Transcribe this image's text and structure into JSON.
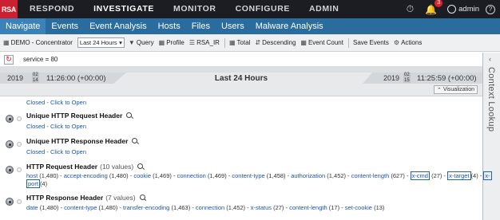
{
  "topnav": {
    "logo": "RSA",
    "items": [
      "RESPOND",
      "INVESTIGATE",
      "MONITOR",
      "CONFIGURE",
      "ADMIN"
    ],
    "active": "INVESTIGATE",
    "notifications_count": "3",
    "user": "admin"
  },
  "subnav": {
    "tabs": [
      "Navigate",
      "Events",
      "Event Analysis",
      "Hosts",
      "Files",
      "Users",
      "Malware Analysis"
    ],
    "active": "Navigate"
  },
  "toolbar": {
    "service": "DEMO - Concentrator",
    "time_range": "Last 24 Hours",
    "query": "Query",
    "profile": "Profile",
    "rsa_ir": "RSA_IR",
    "total": "Total",
    "sort": "Descending",
    "event_count": "Event Count",
    "save_events": "Save Events",
    "actions": "Actions"
  },
  "filter": {
    "text": "service = 80"
  },
  "timeline": {
    "start_year": "2019",
    "start_month": "02",
    "start_day": "14",
    "start_time": "11:26:00 (+00:00)",
    "label": "Last 24 Hours",
    "end_year": "2019",
    "end_month": "02",
    "end_day": "15",
    "end_time": "11:25:59 (+00:00)",
    "visualization": "Visualization"
  },
  "context_lookup": "Context Lookup",
  "meta": {
    "closed_link": "Closed - Click to Open",
    "uniq_req_title": "Unique HTTP Request Header",
    "uniq_resp_title": "Unique HTTP Response Header",
    "req_title": "HTTP Request Header",
    "req_count": "(10 values)",
    "req_values": [
      {
        "name": "host",
        "count": "(1,480)"
      },
      {
        "name": "accept-encoding",
        "count": "(1,480)"
      },
      {
        "name": "cookie",
        "count": "(1,469)"
      },
      {
        "name": "connection",
        "count": "(1,469)"
      },
      {
        "name": "content-type",
        "count": "(1,458)"
      },
      {
        "name": "authorization",
        "count": "(1,452)"
      },
      {
        "name": "content-length",
        "count": "(627)"
      },
      {
        "name": "x-cmd",
        "count": "(27)"
      },
      {
        "name": "x-target",
        "count": "(4)"
      },
      {
        "name": "x-",
        "count": ""
      },
      {
        "name": "port",
        "count": "(4)"
      }
    ],
    "resp_title": "HTTP Response Header",
    "resp_count": "(7 values)",
    "resp_values": [
      {
        "name": "date",
        "count": "(1,480)"
      },
      {
        "name": "content-type",
        "count": "(1,480)"
      },
      {
        "name": "transfer-encoding",
        "count": "(1,463)"
      },
      {
        "name": "connection",
        "count": "(1,452)"
      },
      {
        "name": "x-status",
        "count": "(27)"
      },
      {
        "name": "content-length",
        "count": "(17)"
      },
      {
        "name": "set-cookie",
        "count": "(13)"
      }
    ]
  }
}
